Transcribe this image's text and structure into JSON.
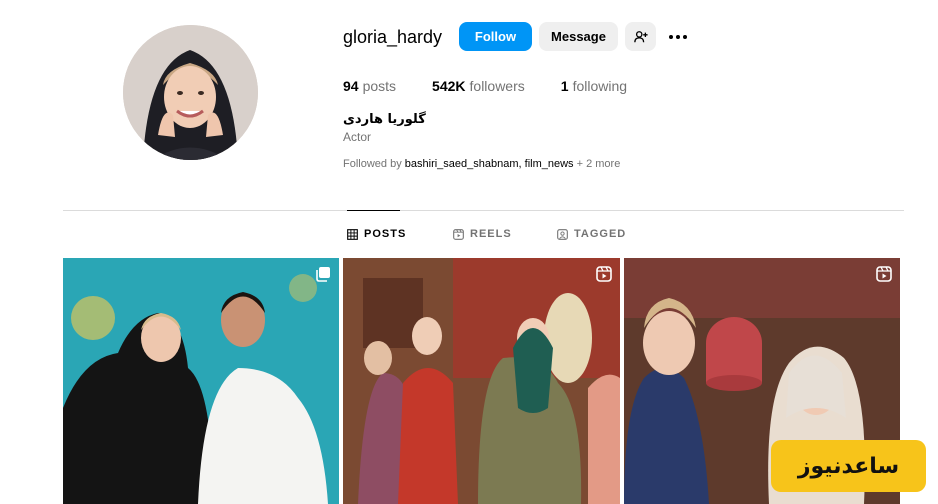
{
  "profile": {
    "username": "gloria_hardy",
    "full_name": "گلوریا هاردی",
    "category": "Actor",
    "follow_label": "Follow",
    "message_label": "Message",
    "posts_count": "94",
    "posts_label": "posts",
    "followers_count": "542K",
    "followers_label": "followers",
    "following_count": "1",
    "following_label": "following",
    "followed_by_prefix": "Followed by",
    "followed_by_user1": "bashiri_saed_shabnam",
    "followed_by_sep": ",",
    "followed_by_user2": "film_news",
    "followed_by_more": "+ 2 more"
  },
  "tabs": [
    {
      "label": "POSTS",
      "icon": "grid-icon",
      "active": true
    },
    {
      "label": "REELS",
      "icon": "reels-icon",
      "active": false
    },
    {
      "label": "TAGGED",
      "icon": "tagged-icon",
      "active": false
    }
  ],
  "posts": [
    {
      "badge": "carousel-icon"
    },
    {
      "badge": "reel-icon"
    },
    {
      "badge": "reel-icon"
    }
  ],
  "watermark": "ساعدنیوز",
  "colors": {
    "accent": "#0095f6",
    "secondary_button": "#efefef",
    "muted_text": "#737373",
    "watermark_bg": "#f7c41a"
  }
}
